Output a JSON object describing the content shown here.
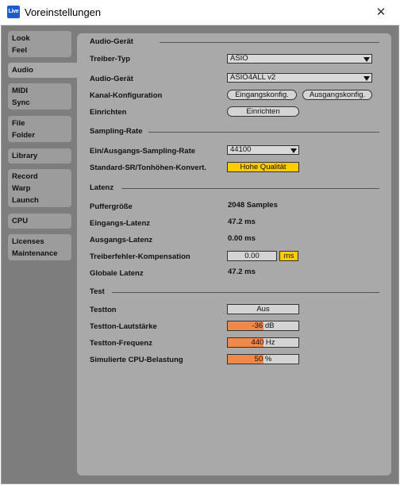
{
  "window": {
    "title": "Voreinstellungen",
    "app_icon": "Live",
    "close_glyph": "✕"
  },
  "tabs": {
    "look_feel": [
      "Look",
      "Feel"
    ],
    "audio": [
      "Audio"
    ],
    "midi_sync": [
      "MIDI",
      "Sync"
    ],
    "file_folder": [
      "File",
      "Folder"
    ],
    "library": [
      "Library"
    ],
    "record": [
      "Record",
      "Warp",
      "Launch"
    ],
    "cpu": [
      "CPU"
    ],
    "licenses": [
      "Licenses",
      "Maintenance"
    ]
  },
  "audio_device": {
    "section": "Audio-Gerät",
    "driver_label": "Treiber-Typ",
    "driver_value": "ASIO",
    "device_label": "Audio-Gerät",
    "device_value": "ASIO4ALL v2",
    "channel_label": "Kanal-Konfiguration",
    "input_config": "Eingangskonfig.",
    "output_config": "Ausgangskonfig.",
    "setup_label": "Einrichten",
    "setup_button": "Einrichten"
  },
  "sample_rate": {
    "section": "Sampling-Rate",
    "io_label": "Ein/Ausgangs-Sampling-Rate",
    "io_value": "44100",
    "default_label": "Standard-SR/Tonhöhen-Konvert.",
    "default_value": "Hohe Qualität"
  },
  "latency": {
    "section": "Latenz",
    "buffer_label": "Puffergröße",
    "buffer_value": "2048 Samples",
    "input_label": "Eingangs-Latenz",
    "input_value": "47.2 ms",
    "output_label": "Ausgangs-Latenz",
    "output_value": "0.00 ms",
    "driver_comp_label": "Treiberfehler-Kompensation",
    "driver_comp_value": "0.00",
    "driver_comp_unit": "ms",
    "overall_label": "Globale Latenz",
    "overall_value": "47.2 ms"
  },
  "test": {
    "section": "Test",
    "tone_label": "Testton",
    "tone_value": "Aus",
    "volume_label": "Testton-Lautstärke",
    "volume_value": "-36 dB",
    "volume_fill": 0.5,
    "freq_label": "Testton-Frequenz",
    "freq_value": "440 Hz",
    "freq_fill": 0.5,
    "cpu_label": "Simulierte CPU-Belastung",
    "cpu_value": "50 %",
    "cpu_fill": 0.5
  },
  "colors": {
    "accent_orange": "#f0884a",
    "accent_yellow": "#ffcc00",
    "panel": "#a9a9a9",
    "background": "#7d7d7d"
  }
}
